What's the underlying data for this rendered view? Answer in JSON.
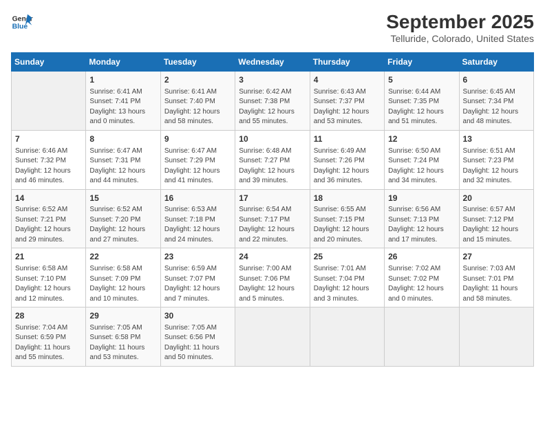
{
  "header": {
    "logo_line1": "General",
    "logo_line2": "Blue",
    "title": "September 2025",
    "subtitle": "Telluride, Colorado, United States"
  },
  "weekdays": [
    "Sunday",
    "Monday",
    "Tuesday",
    "Wednesday",
    "Thursday",
    "Friday",
    "Saturday"
  ],
  "weeks": [
    [
      {
        "day": "",
        "content": ""
      },
      {
        "day": "1",
        "content": "Sunrise: 6:41 AM\nSunset: 7:41 PM\nDaylight: 13 hours\nand 0 minutes."
      },
      {
        "day": "2",
        "content": "Sunrise: 6:41 AM\nSunset: 7:40 PM\nDaylight: 12 hours\nand 58 minutes."
      },
      {
        "day": "3",
        "content": "Sunrise: 6:42 AM\nSunset: 7:38 PM\nDaylight: 12 hours\nand 55 minutes."
      },
      {
        "day": "4",
        "content": "Sunrise: 6:43 AM\nSunset: 7:37 PM\nDaylight: 12 hours\nand 53 minutes."
      },
      {
        "day": "5",
        "content": "Sunrise: 6:44 AM\nSunset: 7:35 PM\nDaylight: 12 hours\nand 51 minutes."
      },
      {
        "day": "6",
        "content": "Sunrise: 6:45 AM\nSunset: 7:34 PM\nDaylight: 12 hours\nand 48 minutes."
      }
    ],
    [
      {
        "day": "7",
        "content": "Sunrise: 6:46 AM\nSunset: 7:32 PM\nDaylight: 12 hours\nand 46 minutes."
      },
      {
        "day": "8",
        "content": "Sunrise: 6:47 AM\nSunset: 7:31 PM\nDaylight: 12 hours\nand 44 minutes."
      },
      {
        "day": "9",
        "content": "Sunrise: 6:47 AM\nSunset: 7:29 PM\nDaylight: 12 hours\nand 41 minutes."
      },
      {
        "day": "10",
        "content": "Sunrise: 6:48 AM\nSunset: 7:27 PM\nDaylight: 12 hours\nand 39 minutes."
      },
      {
        "day": "11",
        "content": "Sunrise: 6:49 AM\nSunset: 7:26 PM\nDaylight: 12 hours\nand 36 minutes."
      },
      {
        "day": "12",
        "content": "Sunrise: 6:50 AM\nSunset: 7:24 PM\nDaylight: 12 hours\nand 34 minutes."
      },
      {
        "day": "13",
        "content": "Sunrise: 6:51 AM\nSunset: 7:23 PM\nDaylight: 12 hours\nand 32 minutes."
      }
    ],
    [
      {
        "day": "14",
        "content": "Sunrise: 6:52 AM\nSunset: 7:21 PM\nDaylight: 12 hours\nand 29 minutes."
      },
      {
        "day": "15",
        "content": "Sunrise: 6:52 AM\nSunset: 7:20 PM\nDaylight: 12 hours\nand 27 minutes."
      },
      {
        "day": "16",
        "content": "Sunrise: 6:53 AM\nSunset: 7:18 PM\nDaylight: 12 hours\nand 24 minutes."
      },
      {
        "day": "17",
        "content": "Sunrise: 6:54 AM\nSunset: 7:17 PM\nDaylight: 12 hours\nand 22 minutes."
      },
      {
        "day": "18",
        "content": "Sunrise: 6:55 AM\nSunset: 7:15 PM\nDaylight: 12 hours\nand 20 minutes."
      },
      {
        "day": "19",
        "content": "Sunrise: 6:56 AM\nSunset: 7:13 PM\nDaylight: 12 hours\nand 17 minutes."
      },
      {
        "day": "20",
        "content": "Sunrise: 6:57 AM\nSunset: 7:12 PM\nDaylight: 12 hours\nand 15 minutes."
      }
    ],
    [
      {
        "day": "21",
        "content": "Sunrise: 6:58 AM\nSunset: 7:10 PM\nDaylight: 12 hours\nand 12 minutes."
      },
      {
        "day": "22",
        "content": "Sunrise: 6:58 AM\nSunset: 7:09 PM\nDaylight: 12 hours\nand 10 minutes."
      },
      {
        "day": "23",
        "content": "Sunrise: 6:59 AM\nSunset: 7:07 PM\nDaylight: 12 hours\nand 7 minutes."
      },
      {
        "day": "24",
        "content": "Sunrise: 7:00 AM\nSunset: 7:06 PM\nDaylight: 12 hours\nand 5 minutes."
      },
      {
        "day": "25",
        "content": "Sunrise: 7:01 AM\nSunset: 7:04 PM\nDaylight: 12 hours\nand 3 minutes."
      },
      {
        "day": "26",
        "content": "Sunrise: 7:02 AM\nSunset: 7:02 PM\nDaylight: 12 hours\nand 0 minutes."
      },
      {
        "day": "27",
        "content": "Sunrise: 7:03 AM\nSunset: 7:01 PM\nDaylight: 11 hours\nand 58 minutes."
      }
    ],
    [
      {
        "day": "28",
        "content": "Sunrise: 7:04 AM\nSunset: 6:59 PM\nDaylight: 11 hours\nand 55 minutes."
      },
      {
        "day": "29",
        "content": "Sunrise: 7:05 AM\nSunset: 6:58 PM\nDaylight: 11 hours\nand 53 minutes."
      },
      {
        "day": "30",
        "content": "Sunrise: 7:05 AM\nSunset: 6:56 PM\nDaylight: 11 hours\nand 50 minutes."
      },
      {
        "day": "",
        "content": ""
      },
      {
        "day": "",
        "content": ""
      },
      {
        "day": "",
        "content": ""
      },
      {
        "day": "",
        "content": ""
      }
    ]
  ]
}
